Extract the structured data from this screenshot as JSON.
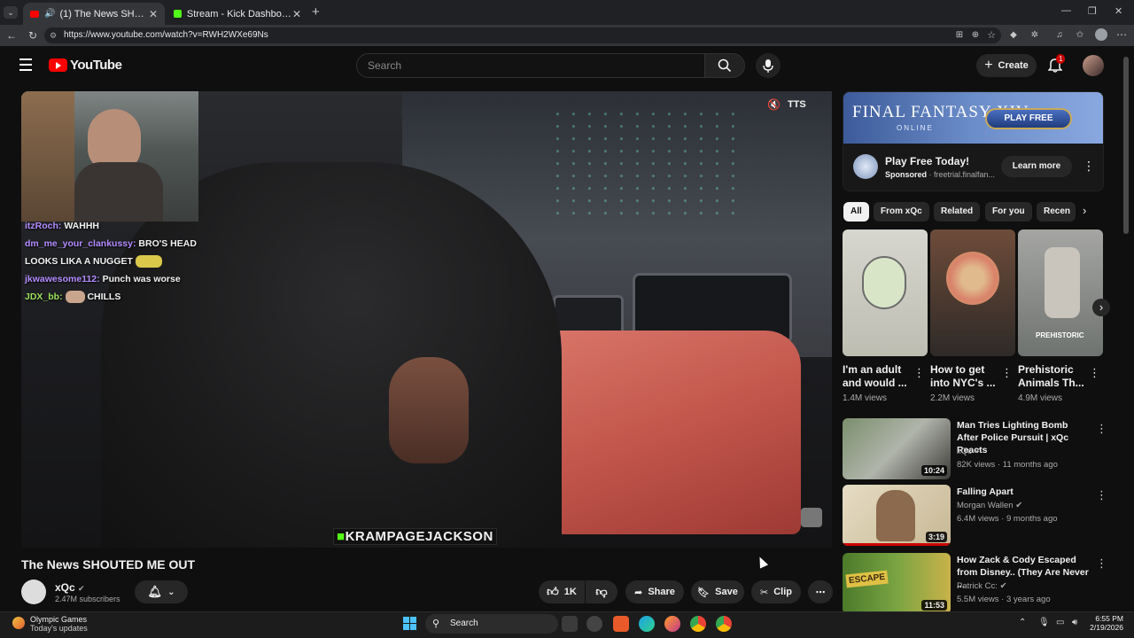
{
  "browser": {
    "tabs": [
      {
        "title": "(1) The News SHOUTED ME OUT",
        "active": true
      },
      {
        "title": "Stream - Kick Dashboard",
        "active": false
      }
    ],
    "url": "https://www.youtube.com/watch?v=RWH2WXe69Ns"
  },
  "youtube": {
    "logo_text": "YouTube",
    "search_placeholder": "Search",
    "create_label": "Create",
    "notification_count": "1",
    "video": {
      "title": "The News SHOUTED ME OUT",
      "channel": "xQc",
      "subscribers": "2.47M subscribers",
      "likes": "1K",
      "share_label": "Share",
      "save_label": "Save",
      "clip_label": "Clip",
      "overlay_tts": "TTS",
      "overlay_caption": "KRAMPAGEJACKSON",
      "chat": [
        {
          "user": "itzRoch:",
          "msg": "WAHHH",
          "color": "#b38cff"
        },
        {
          "user": "dm_me_your_clankussy:",
          "msg": "BRO'S HEAD LOOKS LIKA A NUGGET",
          "color": "#b38cff"
        },
        {
          "user": "jkwawesome112:",
          "msg": "Punch was worse",
          "color": "#b38cff"
        },
        {
          "user": "JDX_bb:",
          "msg": "CHILLS",
          "color": "#9be15d"
        }
      ]
    },
    "ad": {
      "banner_title": "FINAL FANTASY XIV",
      "banner_sub": "ONLINE",
      "banner_button": "PLAY FREE",
      "title": "Play Free Today!",
      "sponsored": "Sponsored",
      "domain": "· freetrial.finalfan...",
      "cta": "Learn more"
    },
    "chips": [
      "All",
      "From xQc",
      "Related",
      "For you",
      "Recen"
    ],
    "shorts": [
      {
        "title": "I'm an adult and would ...",
        "views": "1.4M views"
      },
      {
        "title": "How to get into NYC's ...",
        "views": "2.2M views"
      },
      {
        "title": "Prehistoric Animals Th...",
        "views": "4.9M views",
        "thumb_text": "PREHISTORIC"
      }
    ],
    "recommendations": [
      {
        "title": "Man Tries Lighting Bomb After Police Pursuit | xQc Reacts",
        "channel": "xQc",
        "meta": "82K views · 11 months ago",
        "duration": "10:24"
      },
      {
        "title": "Falling Apart",
        "channel": "Morgan Wallen",
        "meta": "6.4M views · 9 months ago",
        "duration": "3:19"
      },
      {
        "title": "How Zack & Cody Escaped from Disney.. (They Are Never ...",
        "channel": "Patrick Cc:",
        "meta": "5.5M views · 3 years ago",
        "duration": "11:53",
        "thumb_text": "ESCAPE"
      }
    ]
  },
  "taskbar": {
    "weather_title": "Olympic Games",
    "weather_sub": "Today's updates",
    "search_label": "Search",
    "time": "6:55 PM",
    "date": "2/19/2026"
  }
}
